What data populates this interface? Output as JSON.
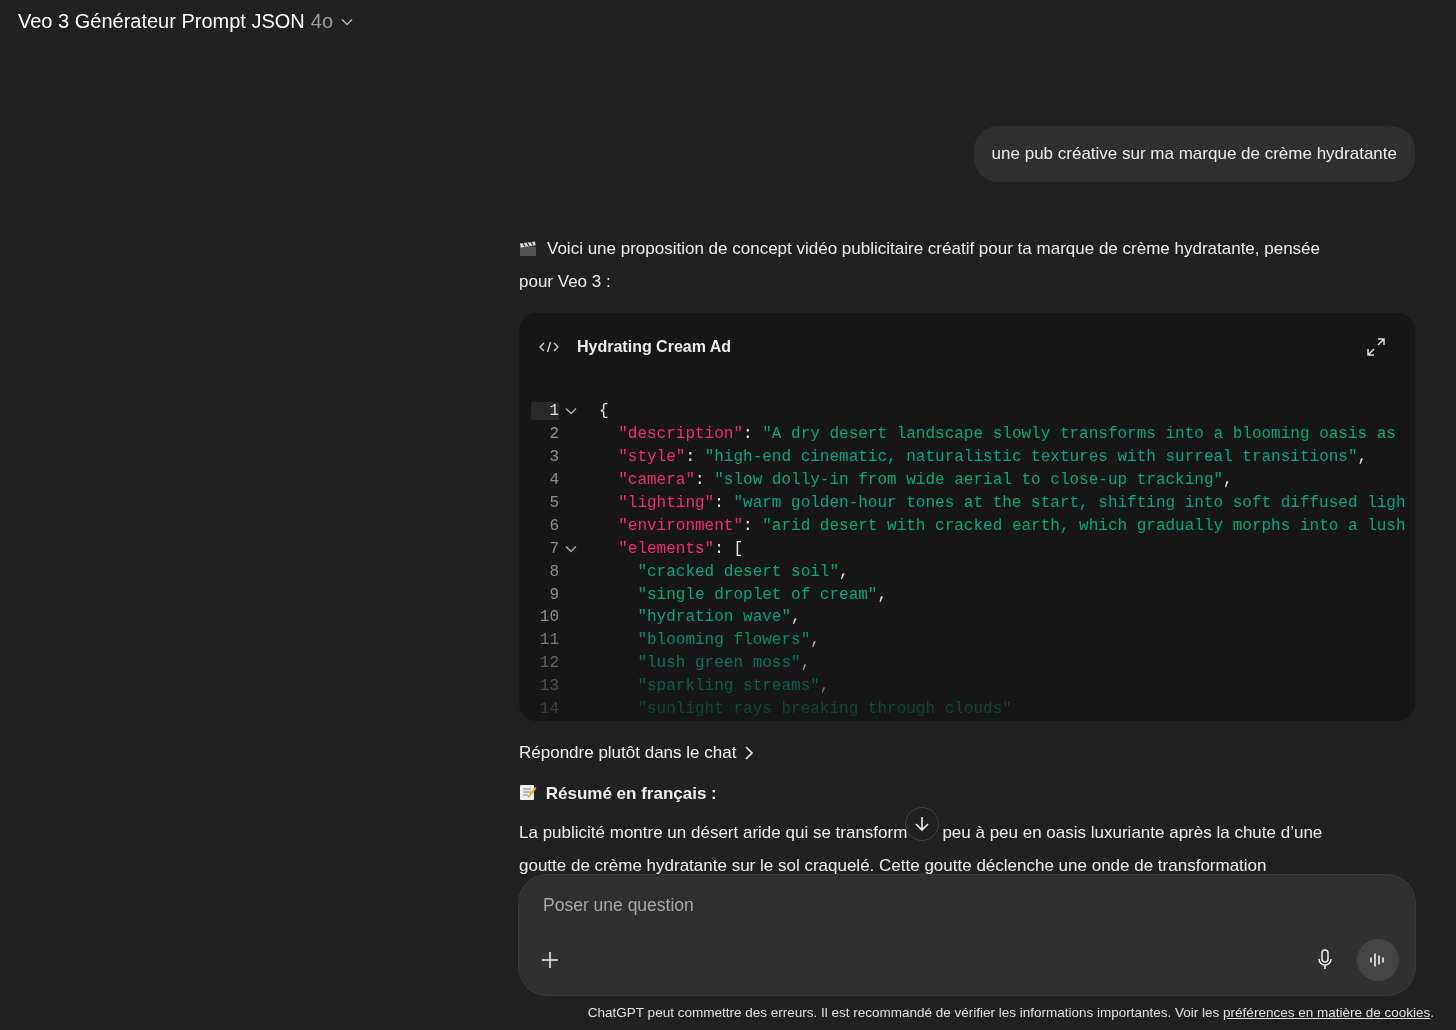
{
  "header": {
    "title": "Veo 3 Générateur Prompt JSON",
    "model": "4o"
  },
  "user_message": "une pub créative sur ma marque de crème hydratante",
  "assistant": {
    "intro_lines": [
      "Voici une proposition de concept vidéo publicitaire créatif pour ta marque de crème hydratante, pensée",
      "pour Veo 3 :"
    ],
    "code_block": {
      "title": "Hydrating Cream Ad",
      "lines": [
        {
          "number": "1",
          "kind": "brace",
          "foldable": true,
          "active": true,
          "tokens": [
            {
              "kind": "punct",
              "text": "{"
            }
          ]
        },
        {
          "number": "2",
          "kind": "property",
          "foldable": false,
          "active": false,
          "tokens": [
            {
              "kind": "key",
              "text": "\"description\""
            },
            {
              "kind": "punct",
              "text": ": "
            },
            {
              "kind": "string",
              "text": "\"A dry desert landscape slowly transforms into a blooming oasis as"
            }
          ]
        },
        {
          "number": "3",
          "kind": "property",
          "foldable": false,
          "active": false,
          "tokens": [
            {
              "kind": "key",
              "text": "\"style\""
            },
            {
              "kind": "punct",
              "text": ": "
            },
            {
              "kind": "string",
              "text": "\"high-end cinematic, naturalistic textures with surreal transitions\""
            },
            {
              "kind": "punct",
              "text": ","
            }
          ]
        },
        {
          "number": "4",
          "kind": "property",
          "foldable": false,
          "active": false,
          "tokens": [
            {
              "kind": "key",
              "text": "\"camera\""
            },
            {
              "kind": "punct",
              "text": ": "
            },
            {
              "kind": "string",
              "text": "\"slow dolly-in from wide aerial to close-up tracking\""
            },
            {
              "kind": "punct",
              "text": ","
            }
          ]
        },
        {
          "number": "5",
          "kind": "property",
          "foldable": false,
          "active": false,
          "tokens": [
            {
              "kind": "key",
              "text": "\"lighting\""
            },
            {
              "kind": "punct",
              "text": ": "
            },
            {
              "kind": "string",
              "text": "\"warm golden-hour tones at the start, shifting into soft diffused ligh"
            }
          ]
        },
        {
          "number": "6",
          "kind": "property",
          "foldable": false,
          "active": false,
          "tokens": [
            {
              "kind": "key",
              "text": "\"environment\""
            },
            {
              "kind": "punct",
              "text": ": "
            },
            {
              "kind": "string",
              "text": "\"arid desert with cracked earth, which gradually morphs into a lush"
            }
          ]
        },
        {
          "number": "7",
          "kind": "property",
          "foldable": true,
          "active": false,
          "tokens": [
            {
              "kind": "key",
              "text": "\"elements\""
            },
            {
              "kind": "punct",
              "text": ": ["
            }
          ]
        },
        {
          "number": "8",
          "kind": "item",
          "foldable": false,
          "active": false,
          "tokens": [
            {
              "kind": "string",
              "text": "\"cracked desert soil\""
            },
            {
              "kind": "punct",
              "text": ","
            }
          ]
        },
        {
          "number": "9",
          "kind": "item",
          "foldable": false,
          "active": false,
          "tokens": [
            {
              "kind": "string",
              "text": "\"single droplet of cream\""
            },
            {
              "kind": "punct",
              "text": ","
            }
          ]
        },
        {
          "number": "10",
          "kind": "item",
          "foldable": false,
          "active": false,
          "tokens": [
            {
              "kind": "string",
              "text": "\"hydration wave\""
            },
            {
              "kind": "punct",
              "text": ","
            }
          ]
        },
        {
          "number": "11",
          "kind": "item",
          "foldable": false,
          "active": false,
          "tokens": [
            {
              "kind": "string",
              "text": "\"blooming flowers\""
            },
            {
              "kind": "punct",
              "text": ","
            }
          ]
        },
        {
          "number": "12",
          "kind": "item",
          "foldable": false,
          "active": false,
          "tokens": [
            {
              "kind": "string",
              "text": "\"lush green moss\""
            },
            {
              "kind": "punct",
              "text": ","
            }
          ]
        },
        {
          "number": "13",
          "kind": "item",
          "foldable": false,
          "active": false,
          "tokens": [
            {
              "kind": "string",
              "text": "\"sparkling streams\""
            },
            {
              "kind": "punct",
              "text": ","
            }
          ]
        },
        {
          "number": "14",
          "kind": "item",
          "foldable": false,
          "active": false,
          "tokens": [
            {
              "kind": "string",
              "text": "\"sunlight rays breaking through clouds\""
            }
          ]
        }
      ]
    },
    "chat_link": "Répondre plutôt dans le chat",
    "summary_heading": "Résumé en français :",
    "summary_lines": [
      [
        "La publicité montre un désert aride qui se transform",
        "peu à peu en oasis luxuriante après la chute d’une"
      ],
      [
        "goutte de crème hydratante sur le sol craquelé. Cette goutte déclenche une onde de transformation"
      ]
    ]
  },
  "composer": {
    "placeholder": "Poser une question"
  },
  "footer": {
    "text": "ChatGPT peut commettre des erreurs. Il est recommandé de vérifier les informations importantes. Voir les",
    "link": "préférences en matière de cookies",
    "end": "."
  }
}
